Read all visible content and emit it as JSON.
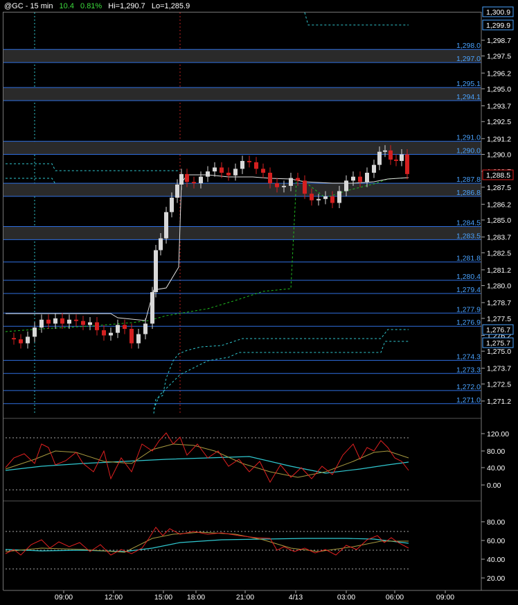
{
  "title": {
    "symbol": "@GC - 15 min",
    "change": "10.4",
    "change_pct": "0.81%",
    "hi": "Hi=1,290.7",
    "lo": "Lo=1,285.9"
  },
  "price_axis": {
    "ticks": [
      "1,298.7",
      "1,297.5",
      "1,296.2",
      "1,295.0",
      "1,293.7",
      "1,292.5",
      "1,291.2",
      "1,290.0",
      "1,288.7",
      "1,287.5",
      "1,286.2",
      "1,285.0",
      "1,283.7",
      "1,282.5",
      "1,281.2",
      "1,280.0",
      "1,278.7",
      "1,277.5",
      "1,276.2",
      "1,275.0",
      "1,273.7",
      "1,272.5",
      "1,271.2"
    ],
    "badges": [
      {
        "text": "1,300.9",
        "color": "#4aa3ff"
      },
      {
        "text": "1,299.9",
        "color": "#4aa3ff"
      },
      {
        "text": "1,288.5",
        "color": "#e02020"
      },
      {
        "text": "1,276.7",
        "color": "#4aa3ff"
      },
      {
        "text": "1,275.7",
        "color": "#4aa3ff"
      }
    ],
    "partial_top": "1,300.?"
  },
  "level_lines": [
    "1,298.0",
    "1,297.0",
    "1,295.1",
    "1,294.1",
    "1,291.0",
    "1,290.0",
    "1,287.8",
    "1,286.8",
    "1,284.5",
    "1,283.5",
    "1,281.8",
    "1,280.4",
    "1,279.4",
    "1,277.9",
    "1,276.9",
    "1,274.3",
    "1,273.3",
    "1,272.0",
    "1,271.0"
  ],
  "indicator1_axis": [
    "120.00",
    "80.00",
    "40.00",
    "0.00"
  ],
  "indicator2_axis": [
    "80.00",
    "60.00",
    "40.00",
    "20.00"
  ],
  "time_axis": [
    "09:00",
    "12:00",
    "15:00",
    "18:00",
    "21:00",
    "4/13",
    "03:00",
    "06:00",
    "09:00"
  ],
  "colors": {
    "level_line": "#2f6fe0",
    "level_label": "#4aa3ff",
    "up_candle": "#d8d8d8",
    "down_candle": "#d42020",
    "osc_red": "#e02020",
    "osc_cyan": "#30c8d0",
    "osc_olive": "#a89a40",
    "dashed_green": "#20c020",
    "dashed_cyan": "#30c8d0"
  },
  "chart_data": {
    "type": "candlestick",
    "symbol": "@GC",
    "interval": "15 min",
    "y_range": [
      1270.5,
      1301.0
    ],
    "series": [
      {
        "name": "price",
        "close_last": 1288.5,
        "high": 1290.7,
        "low": 1285.9
      }
    ]
  }
}
